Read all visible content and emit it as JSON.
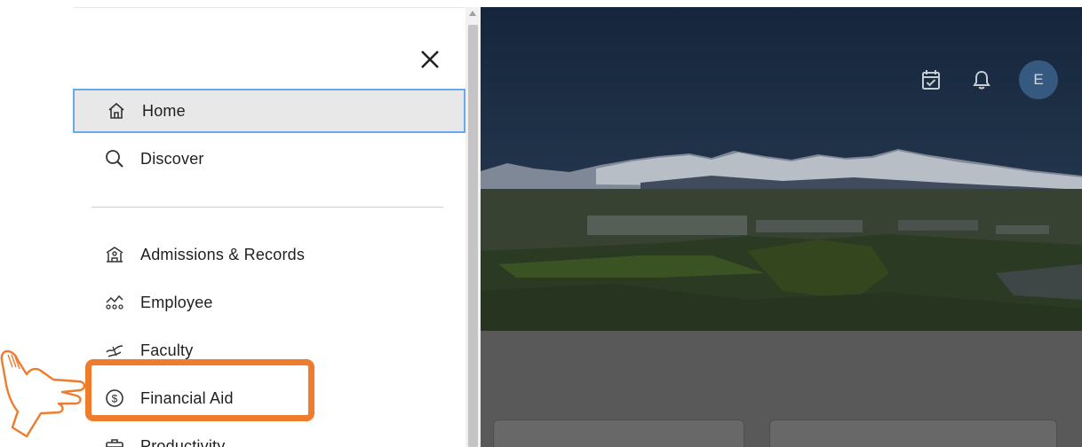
{
  "drawer": {
    "close_label": "Close",
    "items": [
      {
        "label": "Home",
        "icon": "home-icon",
        "active": true
      },
      {
        "label": "Discover",
        "icon": "search-icon",
        "active": false
      },
      {
        "label": "Admissions & Records",
        "icon": "building-icon",
        "active": false
      },
      {
        "label": "Employee",
        "icon": "employee-icon",
        "active": false
      },
      {
        "label": "Faculty",
        "icon": "faculty-icon",
        "active": false
      },
      {
        "label": "Financial Aid",
        "icon": "dollar-icon",
        "active": false
      },
      {
        "label": "Productivity",
        "icon": "briefcase-icon",
        "active": false
      }
    ]
  },
  "header": {
    "avatar_initial": "E",
    "icons": [
      "calendar-check-icon",
      "bell-icon"
    ]
  },
  "colors": {
    "highlight": "#ef7c2d",
    "active_border": "#6aa9ee",
    "active_bg": "#e8e8e8",
    "avatar_bg": "#35597f"
  }
}
